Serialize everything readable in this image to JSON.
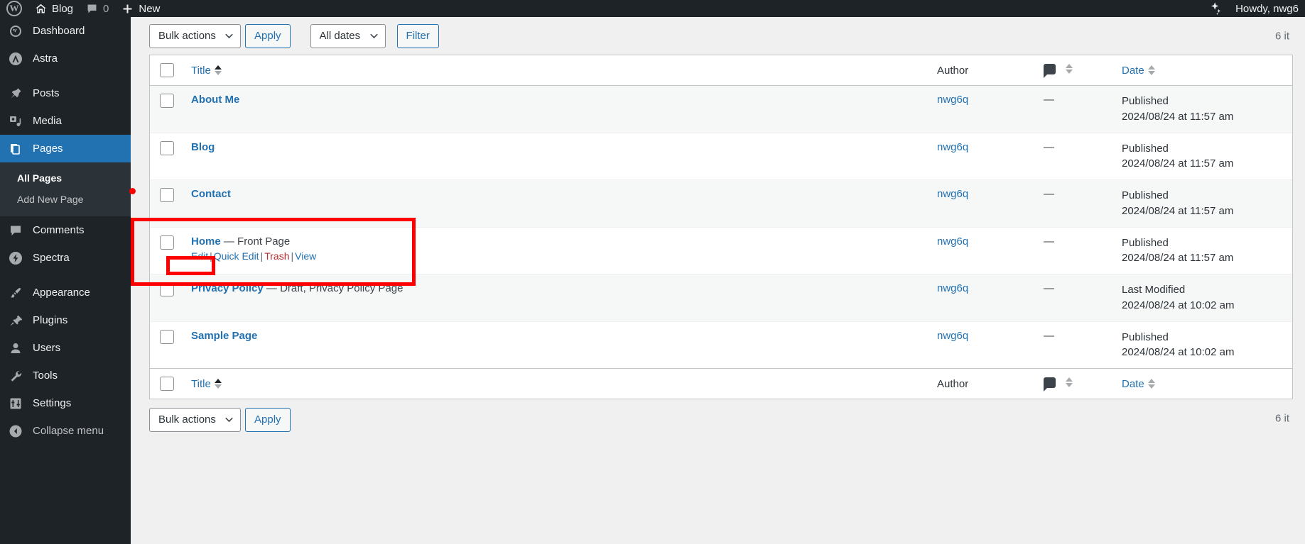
{
  "adminbar": {
    "logo_icon": "wordpress-logo-icon",
    "site_icon": "home-icon",
    "site_name": "Blog",
    "comments_icon": "comment-bubble-icon",
    "comments_count": "0",
    "new_icon": "plus-icon",
    "new_label": "New",
    "spark_icon": "sparkle-icon",
    "howdy": "Howdy, nwg6"
  },
  "sidebar": {
    "items": [
      {
        "label": "Dashboard",
        "icon": "dashboard-gauge-icon",
        "name": "sidebar-item-dashboard",
        "current": false
      },
      {
        "label": "Astra",
        "icon": "astra-logo-icon",
        "name": "sidebar-item-astra",
        "current": false
      },
      {
        "label": "Posts",
        "icon": "pushpin-icon",
        "name": "sidebar-item-posts",
        "current": false
      },
      {
        "label": "Media",
        "icon": "media-camera-icon",
        "name": "sidebar-item-media",
        "current": false
      },
      {
        "label": "Pages",
        "icon": "pages-stack-icon",
        "name": "sidebar-item-pages",
        "current": true
      },
      {
        "label": "Comments",
        "icon": "comment-bubble-icon",
        "name": "sidebar-item-comments",
        "current": false
      },
      {
        "label": "Spectra",
        "icon": "spectra-bolt-icon",
        "name": "sidebar-item-spectra",
        "current": false
      },
      {
        "label": "Appearance",
        "icon": "paintbrush-icon",
        "name": "sidebar-item-appearance",
        "current": false
      },
      {
        "label": "Plugins",
        "icon": "plug-icon",
        "name": "sidebar-item-plugins",
        "current": false
      },
      {
        "label": "Users",
        "icon": "user-icon",
        "name": "sidebar-item-users",
        "current": false
      },
      {
        "label": "Tools",
        "icon": "wrench-icon",
        "name": "sidebar-item-tools",
        "current": false
      },
      {
        "label": "Settings",
        "icon": "sliders-icon",
        "name": "sidebar-item-settings",
        "current": false
      }
    ],
    "submenu": {
      "all_pages": "All Pages",
      "add_new_page": "Add New Page"
    },
    "collapse": {
      "label": "Collapse menu",
      "icon": "chevron-left-circle-icon"
    }
  },
  "toolbar_top": {
    "bulk_actions_value": "Bulk actions",
    "apply_label": "Apply",
    "dates_value": "All dates",
    "filter_label": "Filter",
    "displaying_num": "6 it"
  },
  "toolbar_bottom": {
    "bulk_actions_value": "Bulk actions",
    "apply_label": "Apply",
    "displaying_num": "6 it"
  },
  "table": {
    "columns": {
      "title": "Title",
      "author": "Author",
      "comments_icon": "comment-bubble-icon",
      "date": "Date"
    },
    "rows": [
      {
        "title": "About Me",
        "state": "",
        "author": "nwg6q",
        "comments": "—",
        "date_status": "Published",
        "date_value": "2024/08/24 at 11:57 am",
        "show_actions": false
      },
      {
        "title": "Blog",
        "state": "",
        "author": "nwg6q",
        "comments": "—",
        "date_status": "Published",
        "date_value": "2024/08/24 at 11:57 am",
        "show_actions": false
      },
      {
        "title": "Contact",
        "state": "",
        "author": "nwg6q",
        "comments": "—",
        "date_status": "Published",
        "date_value": "2024/08/24 at 11:57 am",
        "show_actions": false
      },
      {
        "title": "Home",
        "state": "— Front Page",
        "author": "nwg6q",
        "comments": "—",
        "date_status": "Published",
        "date_value": "2024/08/24 at 11:57 am",
        "show_actions": true
      },
      {
        "title": "Privacy Policy",
        "state": "— Draft, Privacy Policy Page",
        "author": "nwg6q",
        "comments": "—",
        "date_status": "Last Modified",
        "date_value": "2024/08/24 at 10:02 am",
        "show_actions": false
      },
      {
        "title": "Sample Page",
        "state": "",
        "author": "nwg6q",
        "comments": "—",
        "date_status": "Published",
        "date_value": "2024/08/24 at 10:02 am",
        "show_actions": false
      }
    ],
    "row_actions": {
      "edit": "Edit",
      "quick_edit": "Quick Edit",
      "trash": "Trash",
      "view": "View",
      "separator": "|"
    }
  },
  "annotations": {
    "accent_color": "#ff0000",
    "highlight_row": "Home",
    "highlight_link": "Edit"
  }
}
